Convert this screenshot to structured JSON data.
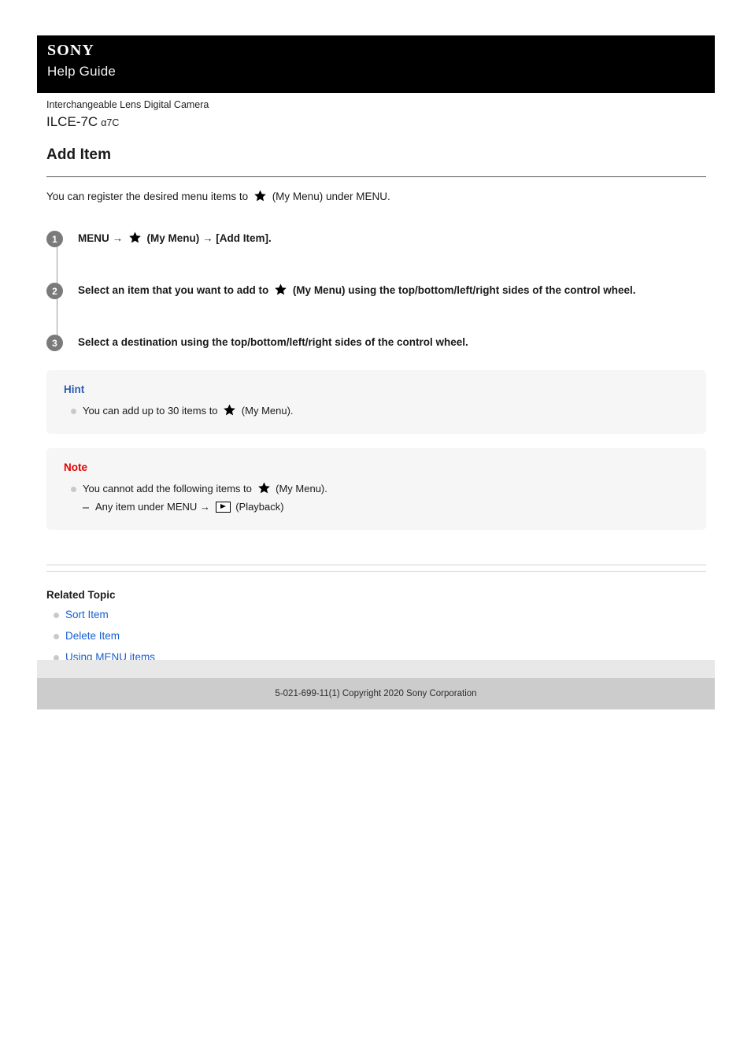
{
  "header": {
    "brand": "SONY",
    "guide_label": "Help Guide"
  },
  "product": {
    "category": "Interchangeable Lens Digital Camera",
    "model": "ILCE-7C",
    "alias": "α7C"
  },
  "article": {
    "title": "Add Item",
    "intro_before_star": "You can register the desired menu items to",
    "intro_after_star": "(My Menu) under MENU.",
    "steps": [
      {
        "number": "1",
        "before_star": "MENU →",
        "after_star": "(My Menu) → [Add Item]."
      },
      {
        "number": "2",
        "before_star": "Select an item that you want to add to",
        "after_star": "(My Menu) using the top/bottom/left/right sides of the control wheel."
      },
      {
        "number": "3",
        "before_star": "Select a destination using the top/bottom/left/right sides of the control wheel.",
        "after_star": ""
      }
    ]
  },
  "hint": {
    "title": "Hint",
    "item_before_star": "You can add up to 30 items to",
    "item_after_star": "(My Menu)."
  },
  "note": {
    "title": "Note",
    "item_before_star": "You cannot add the following items to",
    "item_after_star": "(My Menu).",
    "sub_before_icon": "Any item under MENU →",
    "sub_after_icon": "(Playback)"
  },
  "related": {
    "title": "Related Topic",
    "links": [
      {
        "label": "Sort Item"
      },
      {
        "label": "Delete Item"
      },
      {
        "label": "Using MENU items"
      }
    ]
  },
  "footer": {
    "copyright": "5-021-699-11(1) Copyright 2020 Sony Corporation"
  },
  "icons": {
    "star": "star-icon",
    "playback": "playback-icon"
  },
  "colors": {
    "banner": "#000000",
    "hint_title": "#2a5db0",
    "note_title": "#e60000",
    "link": "#1a5fd0",
    "callout_bg": "#f6f6f6",
    "footer_bar": "#cccccc",
    "footer_top": "#e8e8e8",
    "step_circle": "#7a7a7a"
  }
}
